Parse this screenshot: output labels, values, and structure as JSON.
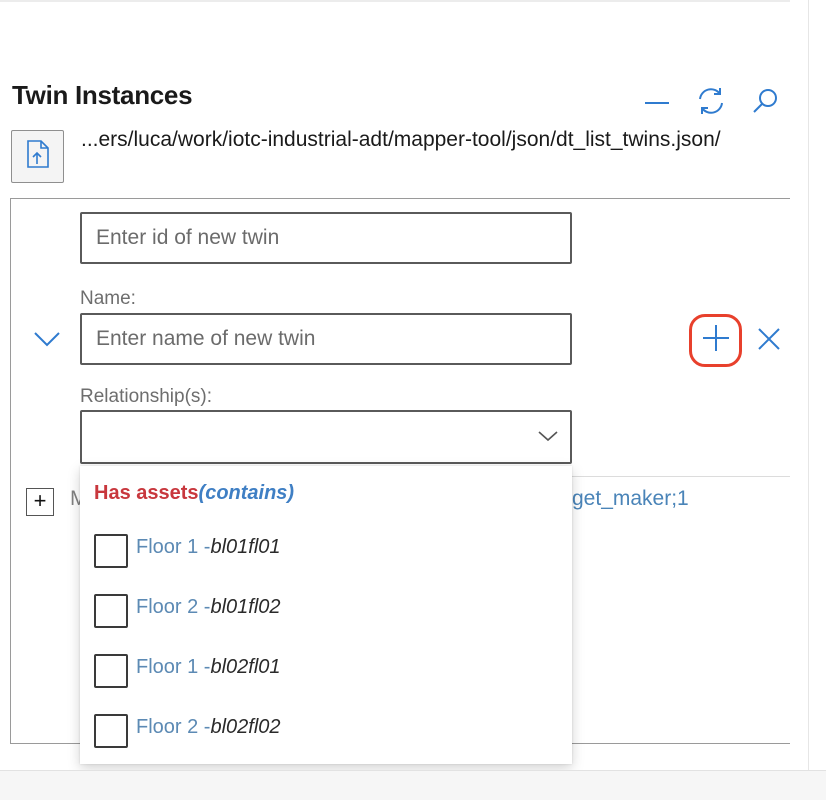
{
  "panel": {
    "title": "Twin Instances",
    "file_path": "...ers/luca/work/iotc-industrial-adt/mapper-tool/json/dt_list_twins.json/"
  },
  "header_icons": [
    "minimize-icon",
    "refresh-icon",
    "search-icon",
    "upload-file-icon"
  ],
  "new_twin_form": {
    "id_placeholder": "Enter id of new twin",
    "name_label": "Name:",
    "name_placeholder": "Enter name of new twin",
    "relationships_label": "Relationship(s):",
    "relationships_selected": ""
  },
  "tree": {
    "toggle": "+",
    "row_label_left": "M",
    "row_label_right": "get_maker;1"
  },
  "relationship_dropdown": {
    "relationship_name": "Has assets",
    "relationship_kind": "(contains)",
    "options": [
      {
        "name": "Floor 1 -",
        "id": "bl01fl01",
        "checked": false
      },
      {
        "name": "Floor 2 -",
        "id": "bl01fl02",
        "checked": false
      },
      {
        "name": "Floor 1 -",
        "id": "bl02fl01",
        "checked": false
      },
      {
        "name": "Floor 2 -",
        "id": "bl02fl02",
        "checked": false
      }
    ]
  },
  "colors": {
    "accent_blue": "#2f7bcf",
    "highlight_red": "#e8402c",
    "relationship_red": "#c8373d",
    "item_blue": "#5c8ab4"
  }
}
